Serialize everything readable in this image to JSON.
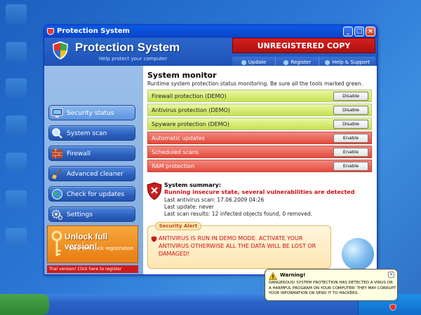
{
  "window": {
    "title": "Protection System"
  },
  "header": {
    "app_title": "Protection System",
    "app_subtitle": "Help protect your computer",
    "unregistered": "UNREGISTERED COPY",
    "toolbar": [
      {
        "label": "Update",
        "icon": "update-icon"
      },
      {
        "label": "Register",
        "icon": "register-icon"
      },
      {
        "label": "Help & Support",
        "icon": "help-icon"
      }
    ]
  },
  "sidebar": {
    "items": [
      {
        "label": "Security status",
        "icon": "monitor-icon",
        "active": true
      },
      {
        "label": "System scan",
        "icon": "magnifier-icon",
        "active": false
      },
      {
        "label": "Firewall",
        "icon": "brick-wall-icon",
        "active": false
      },
      {
        "label": "Advanced cleaner",
        "icon": "brush-icon",
        "active": false
      },
      {
        "label": "Check for updates",
        "icon": "globe-icon",
        "active": false
      },
      {
        "label": "Settings",
        "icon": "gears-icon",
        "active": false
      }
    ],
    "unlock_title": "Unlock full version!",
    "unlock_subtitle": "Easy one-click registration",
    "trial_text": "Trial version! Click here to register"
  },
  "main": {
    "title": "System monitor",
    "subtitle": "Runtime system protection status monitoring. Be sure all the tools marked green.",
    "rows": [
      {
        "label": "Firewall protection (DEMO)",
        "button": "Disable",
        "status": "ok"
      },
      {
        "label": "Antivirus protection (DEMO)",
        "button": "Disable",
        "status": "ok"
      },
      {
        "label": "Spyware protection (DEMO)",
        "button": "Disable",
        "status": "ok"
      },
      {
        "label": "Automatic updates",
        "button": "Enable",
        "status": "bad"
      },
      {
        "label": "Scheduled scans",
        "button": "Enable",
        "status": "bad"
      },
      {
        "label": "RAM protection",
        "button": "Enable",
        "status": "bad"
      }
    ],
    "summary": {
      "title": "System summary:",
      "warning": "Running insecure state, several vulnerabilities are detected",
      "last_scan": "Last antivirus scan: 17.06.2009 04:26",
      "last_update": "Last update: never",
      "last_results": "Last scan results: 12 infected objects found, 0 removed."
    },
    "alert": {
      "label": "Security Alert",
      "text": "ANTIVIRUS IS RUN IN DEMO MODE. ACTIVATE YOUR ANTIVIRUS OTHERWISE ALL THE DATA WILL BE LOST OR DAMAGED!"
    }
  },
  "balloon": {
    "title": "Warning!",
    "text": "DANGEROUS! SYSTEM PROTECTION HAS DETECTED A VIRUS OR A HARMFUL PROGRAM ON YOUR COMPUTER! THEY MAY CORRUPT YOUR INFORMATION OR SEND IT TO HACKERS."
  },
  "colors": {
    "accent": "#0b4fd8",
    "ok_row": "#c7e24e",
    "bad_row": "#e24b3b",
    "warning_text": "#d01010",
    "unlock": "#e77d12"
  }
}
